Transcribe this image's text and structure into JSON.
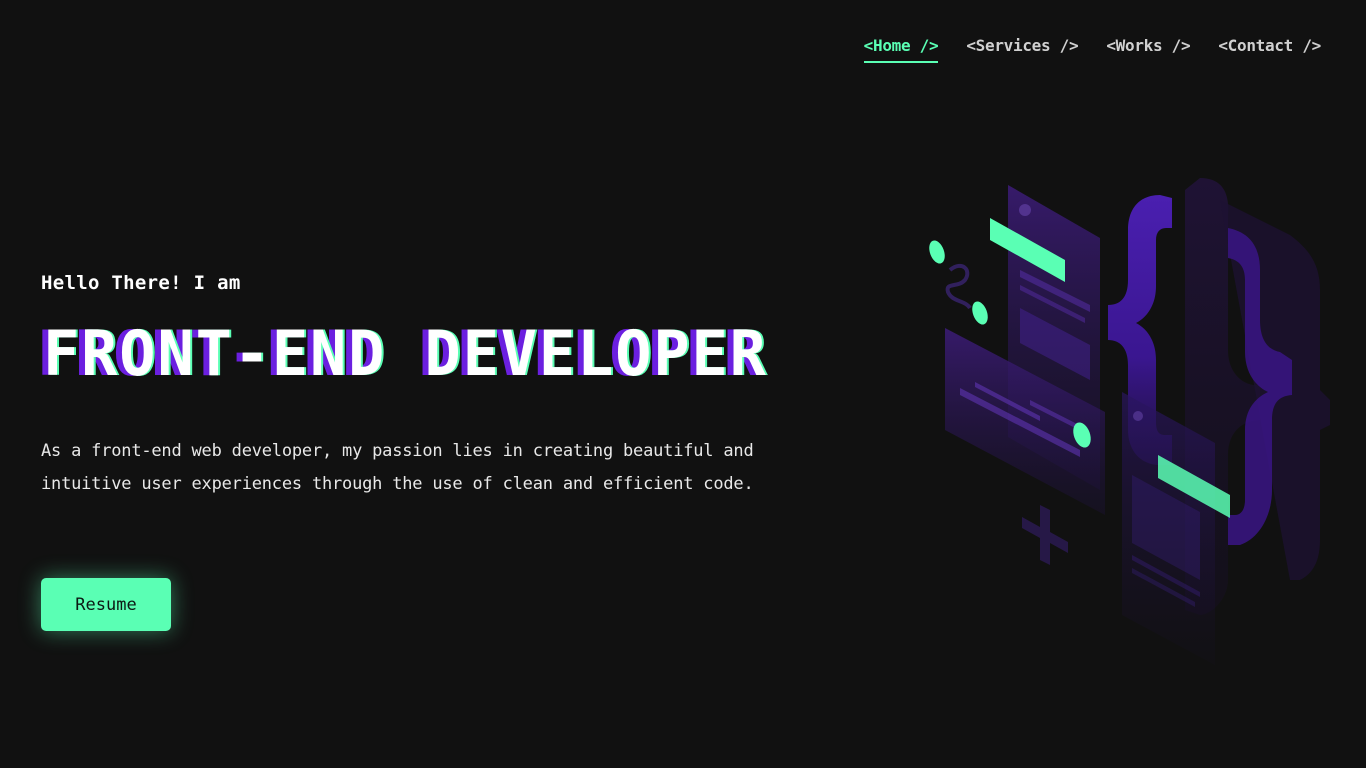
{
  "nav": {
    "items": [
      {
        "label": "<Home />",
        "active": true
      },
      {
        "label": "<Services />",
        "active": false
      },
      {
        "label": "<Works />",
        "active": false
      },
      {
        "label": "<Contact />",
        "active": false
      }
    ]
  },
  "hero": {
    "greeting": "Hello There! I am",
    "title": "FRONT-END DEVELOPER",
    "description": "As a front-end web developer, my passion lies in creating beautiful and intuitive user experiences through the use of clean and efficient code.",
    "resume_label": "Resume"
  },
  "colors": {
    "background": "#111111",
    "accent_green": "#5affb4",
    "accent_purple": "#6b1fe0",
    "text": "#ffffff"
  },
  "icons": {
    "illustration": "code-braces-isometric-illustration"
  }
}
